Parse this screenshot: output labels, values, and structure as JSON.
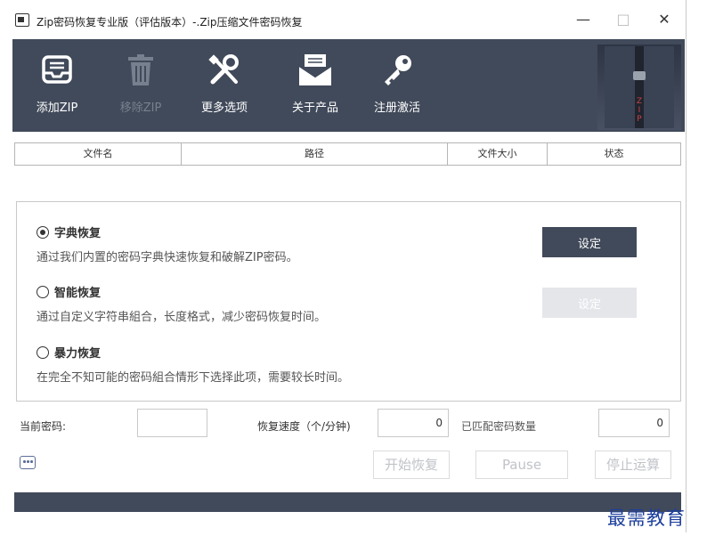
{
  "window": {
    "title": "Zip密码恢复专业版（评估版本）-.Zip压缩文件密码恢复",
    "controls": {
      "minimize": "—",
      "maximize": "□",
      "close": "✕"
    }
  },
  "toolbar": {
    "add_zip": "添加ZIP",
    "remove_zip": "移除ZIP",
    "more_options": "更多选项",
    "about": "关于产品",
    "register": "注册激活"
  },
  "file_table": {
    "columns": [
      "文件名",
      "路径",
      "文件大小",
      "状态"
    ]
  },
  "options": {
    "dictionary": {
      "title": "字典恢复",
      "desc": "通过我们内置的密码字典快速恢复和破解ZIP密码。",
      "selected": true
    },
    "smart": {
      "title": "智能恢复",
      "desc": "通过自定义字符串組合，长度格式，减少密码恢复时间。",
      "selected": false
    },
    "brute": {
      "title": "暴力恢复",
      "desc": "在完全不知可能的密码組合情形下选择此项，需要较长时间。",
      "selected": false
    },
    "set_label": "设定"
  },
  "stats": {
    "current_password_label": "当前密码:",
    "current_password_value": "",
    "speed_label": "恢复速度（个/分钟)",
    "speed_value": "0",
    "matched_label": "已匹配密码数量",
    "matched_value": "0"
  },
  "actions": {
    "start": "开始恢复",
    "pause": "Pause",
    "stop": "停止运算"
  },
  "watermark": "最需教育",
  "colors": {
    "toolbar_bg": "#414a5a",
    "accent_button": "#414a5a",
    "disabled_button": "#e4e6ea"
  }
}
